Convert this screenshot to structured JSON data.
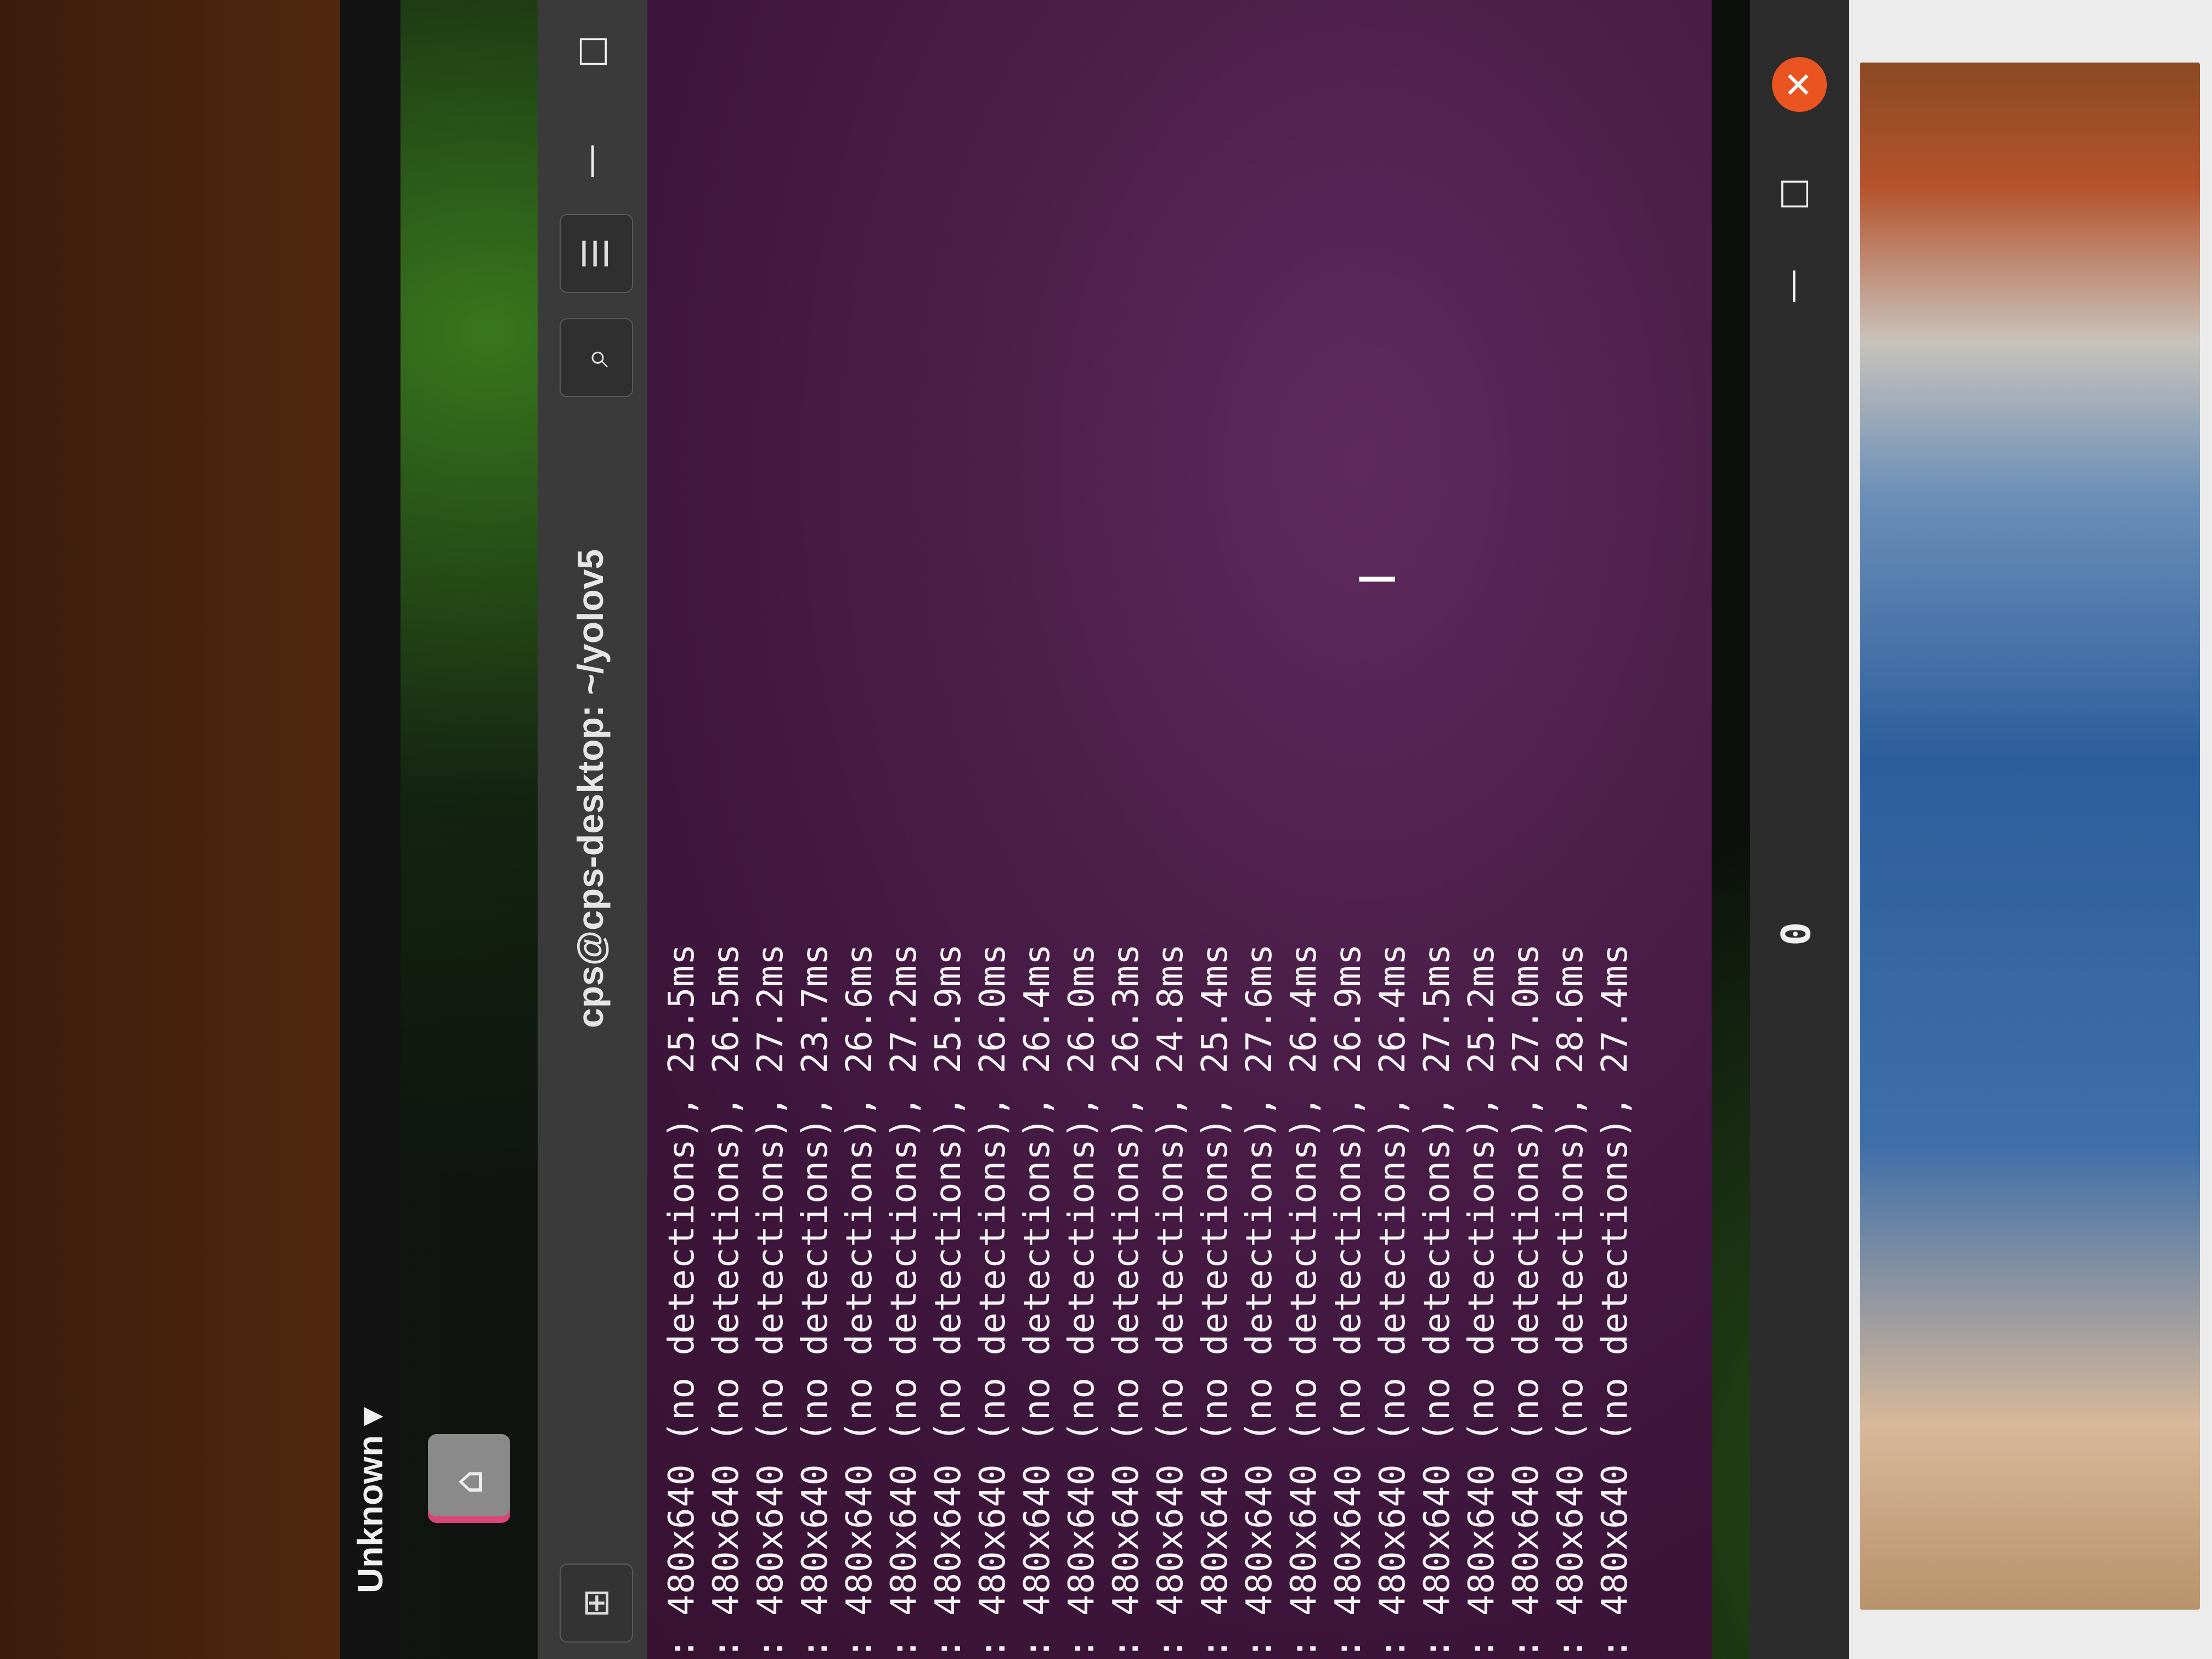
{
  "topbar": {
    "left_label": "Unknown ▾"
  },
  "dock": {
    "home_icon": "home-folder-icon",
    "home_glyph": "⌂"
  },
  "terminal": {
    "title": "cps@cps-desktop: ~/yolov5",
    "new_tab_glyph": "⊞",
    "search_glyph": "⌕",
    "menu_glyph": "☰",
    "min_glyph": "—",
    "max_glyph": "□",
    "lines": [
      ": 480x640 (no detections), 25.5ms",
      ": 480x640 (no detections), 26.5ms",
      ": 480x640 (no detections), 27.2ms",
      ": 480x640 (no detections), 23.7ms",
      ": 480x640 (no detections), 26.6ms",
      ": 480x640 (no detections), 27.2ms",
      ": 480x640 (no detections), 25.9ms",
      ": 480x640 (no detections), 26.0ms",
      ": 480x640 (no detections), 26.4ms",
      ": 480x640 (no detections), 26.0ms",
      ": 480x640 (no detections), 26.3ms",
      ": 480x640 (no detections), 24.8ms",
      ": 480x640 (no detections), 25.4ms",
      ": 480x640 (no detections), 27.6ms",
      ": 480x640 (no detections), 26.4ms",
      ": 480x640 (no detections), 26.9ms",
      ": 480x640 (no detections), 26.4ms",
      ": 480x640 (no detections), 27.5ms",
      ": 480x640 (no detections), 25.2ms",
      ": 480x640 (no detections), 27.0ms",
      ": 480x640 (no detections), 28.6ms",
      ": 480x640 (no detections), 27.4ms"
    ],
    "cursor_glyph": "I"
  },
  "viewer": {
    "title": "0",
    "min_glyph": "—",
    "max_glyph": "□",
    "close_glyph": "✕"
  }
}
